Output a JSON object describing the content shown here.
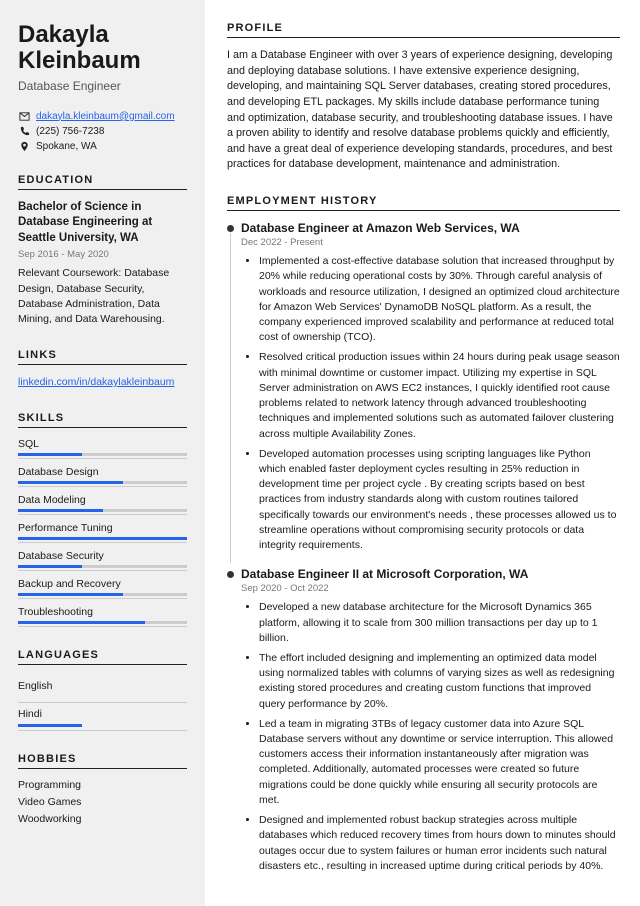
{
  "name": "Dakayla Kleinbaum",
  "title": "Database Engineer",
  "contact": {
    "email": "dakayla.kleinbaum@gmail.com",
    "phone": "(225) 756-7238",
    "location": "Spokane, WA"
  },
  "sections": {
    "education": "EDUCATION",
    "links": "LINKS",
    "skills": "SKILLS",
    "languages": "LANGUAGES",
    "hobbies": "HOBBIES",
    "profile": "PROFILE",
    "employment": "EMPLOYMENT HISTORY"
  },
  "education": {
    "degree": "Bachelor of Science in Database Engineering at Seattle University, WA",
    "dates": "Sep 2016 - May 2020",
    "coursework": "Relevant Coursework: Database Design, Database Security, Database Administration, Data Mining, and Data Warehousing."
  },
  "links": {
    "linkedin": "linkedin.com/in/dakaylakleinbaum"
  },
  "skills": [
    {
      "name": "SQL",
      "pct": 38
    },
    {
      "name": "Database Design",
      "pct": 62
    },
    {
      "name": "Data Modeling",
      "pct": 50
    },
    {
      "name": "Performance Tuning",
      "pct": 100
    },
    {
      "name": "Database Security",
      "pct": 38
    },
    {
      "name": "Backup and Recovery",
      "pct": 62
    },
    {
      "name": "Troubleshooting",
      "pct": 75
    }
  ],
  "languages": [
    {
      "name": "English",
      "pct": 0
    },
    {
      "name": "Hindi",
      "pct": 38
    }
  ],
  "hobbies": [
    "Programming",
    "Video Games",
    "Woodworking"
  ],
  "profile": "I am a Database Engineer with over 3 years of experience designing, developing and deploying database solutions. I have extensive experience designing, developing, and maintaining SQL Server databases, creating stored procedures, and developing ETL packages. My skills include database performance tuning and optimization, database security, and troubleshooting database issues. I have a proven ability to identify and resolve database problems quickly and efficiently, and have a great deal of experience developing standards, procedures, and best practices for database development, maintenance and administration.",
  "jobs": [
    {
      "title": "Database Engineer at Amazon Web Services, WA",
      "dates": "Dec 2022 - Present",
      "bullets": [
        "Implemented a cost-effective database solution that increased throughput by 20% while reducing operational costs by 30%. Through careful analysis of workloads and resource utilization, I designed an optimized cloud architecture for Amazon Web Services' DynamoDB NoSQL platform. As a result, the company experienced improved scalability and performance at reduced total cost of ownership (TCO).",
        "Resolved critical production issues within 24 hours during peak usage season with minimal downtime or customer impact. Utilizing my expertise in SQL Server administration on AWS EC2 instances, I quickly identified root cause problems related to network latency through advanced troubleshooting techniques and implemented solutions such as automated failover clustering across multiple Availability Zones.",
        "Developed automation processes using scripting languages like Python which enabled faster deployment cycles resulting in 25% reduction in development time per project cycle . By creating scripts based on best practices from industry standards along with custom routines tailored specifically towards our environment's needs , these processes allowed us to streamline operations without compromising security protocols or data integrity requirements."
      ]
    },
    {
      "title": "Database Engineer II at Microsoft Corporation, WA",
      "dates": "Sep 2020 - Oct 2022",
      "bullets": [
        "Developed a new database architecture for the Microsoft Dynamics 365 platform, allowing it to scale from 300 million transactions per day up to 1 billion.",
        "The effort included designing and implementing an optimized data model using normalized tables with columns of varying sizes as well as redesigning existing stored procedures and creating custom functions that improved query performance by 20%.",
        "Led a team in migrating 3TBs of legacy customer data into Azure SQL Database servers without any downtime or service interruption. This allowed customers access their information instantaneously after migration was completed. Additionally, automated processes were created so future migrations could be done quickly while ensuring all security protocols are met.",
        "Designed and implemented robust backup strategies across multiple databases which reduced recovery times from hours down to minutes should outages occur due to system failures or human error incidents such natural disasters etc., resulting in increased uptime during critical periods by 40%."
      ]
    }
  ]
}
